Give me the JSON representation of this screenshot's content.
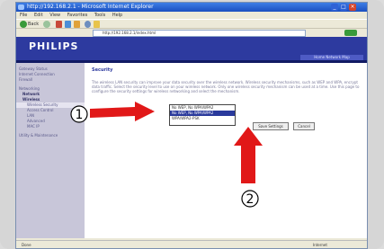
{
  "window": {
    "title": "http://192.168.2.1 - Microsoft Internet Explorer",
    "controls": [
      "_",
      "□",
      "×"
    ]
  },
  "menubar": [
    "File",
    "Edit",
    "View",
    "Favorites",
    "Tools",
    "Help"
  ],
  "toolbar": {
    "back": "Back"
  },
  "address": {
    "url": "http://192.168.2.1/index.html"
  },
  "header": {
    "logo": "PHILIPS",
    "link": "Home  Network Map"
  },
  "sidebar": {
    "items": [
      {
        "label": "Gateway Status"
      },
      {
        "label": "Internet Connection"
      },
      {
        "label": "Firewall"
      },
      {
        "label": "Networking"
      },
      {
        "label": "Network"
      },
      {
        "label": "Wireless"
      },
      {
        "label": "Wireless Security"
      },
      {
        "label": "Access Control"
      },
      {
        "label": "LAN"
      },
      {
        "label": "Advanced"
      },
      {
        "label": "MAC IP"
      },
      {
        "label": "Utility & Maintenance"
      }
    ]
  },
  "main": {
    "heading": "Security",
    "description": "The wireless LAN security can improve your data security over the wireless network. Wireless security mechanisms, such as WEP and WPA, encrypt data traffic. Select the security level to use on your wireless network. Only one wireless security mechanism can be used at a time. Use this page to configure the security settings for wireless networking and select the mechanism.",
    "security_label": "Wireless Security",
    "security_options": [
      "No WEP, No WPA/WPA2",
      "No WEP, No WPA/WPA2",
      "WPA/WPA2-PSK"
    ],
    "save_label": "Save Settings",
    "cancel_label": "Cancel"
  },
  "callouts": [
    "1",
    "2"
  ],
  "status": {
    "left": "Done",
    "right": "Internet"
  }
}
